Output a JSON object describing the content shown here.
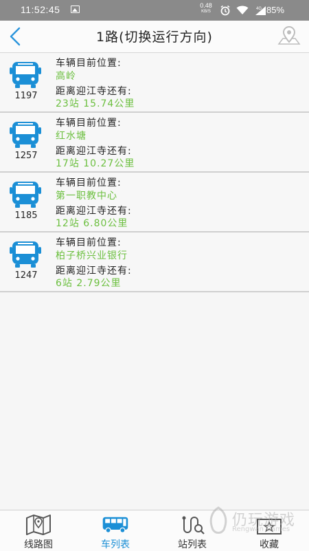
{
  "status_bar": {
    "time": "11:52:45",
    "net_speed_value": "0.48",
    "net_speed_unit": "KB/S",
    "network_type": "4G",
    "battery": "85%"
  },
  "header": {
    "title": "1路(切换运行方向)"
  },
  "buses": [
    {
      "number": "1197",
      "pos_label": "车辆目前位置:",
      "position": "高岭",
      "remain_label": "距离迎江寺还有:",
      "remain": "23站  15.74公里"
    },
    {
      "number": "1257",
      "pos_label": "车辆目前位置:",
      "position": "红水塘",
      "remain_label": "距离迎江寺还有:",
      "remain": "17站  10.27公里"
    },
    {
      "number": "1185",
      "pos_label": "车辆目前位置:",
      "position": "第一职教中心",
      "remain_label": "距离迎江寺还有:",
      "remain": "12站  6.80公里"
    },
    {
      "number": "1247",
      "pos_label": "车辆目前位置:",
      "position": "柏子桥兴业银行",
      "remain_label": "距离迎江寺还有:",
      "remain": "6站  2.79公里"
    }
  ],
  "bottom_nav": {
    "tabs": [
      {
        "label": "线路图",
        "icon": "map-icon"
      },
      {
        "label": "车列表",
        "icon": "bus-icon",
        "active": true
      },
      {
        "label": "站列表",
        "icon": "stop-list-icon"
      },
      {
        "label": "收藏",
        "icon": "favorite-icon"
      }
    ]
  },
  "watermark": {
    "text": "仍玩游戏",
    "sub": "Rengwan Games"
  },
  "colors": {
    "accent_blue": "#1b8fd6",
    "green_text": "#6bbf3e"
  }
}
